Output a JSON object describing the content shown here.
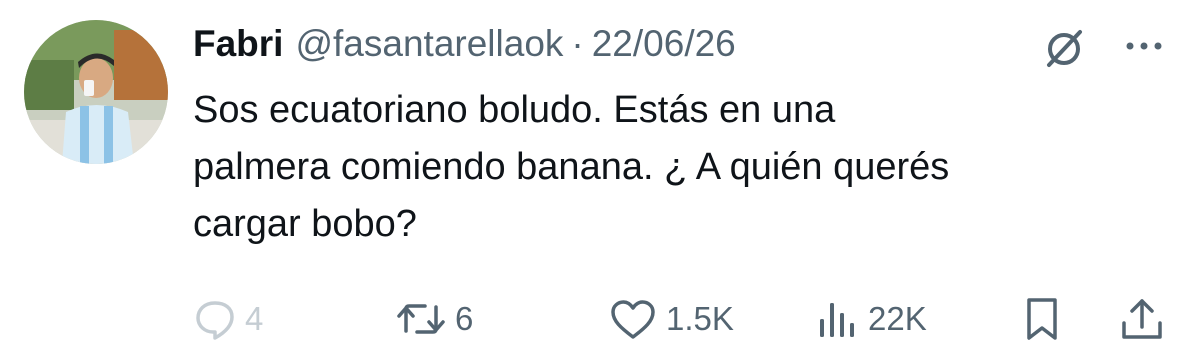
{
  "tweet": {
    "author_name": "Fabri",
    "author_handle": "@fasantarellaok",
    "separator": "·",
    "date": "22/06/26",
    "text": "Sos ecuatoriano boludo. Estás en una\npalmera comiendo banana. ¿ A quién querés\ncargar bobo?"
  },
  "actions": {
    "replies": "4",
    "reposts": "6",
    "likes": "1.5K",
    "views": "22K"
  },
  "icons": {
    "grok": "grok-icon",
    "more": "more-icon",
    "reply": "reply-icon",
    "repost": "repost-icon",
    "like": "heart-icon",
    "views": "views-icon",
    "bookmark": "bookmark-icon",
    "share": "share-icon"
  },
  "colors": {
    "text": "#0f1419",
    "muted": "#536471",
    "faded": "#c5cdd3"
  }
}
